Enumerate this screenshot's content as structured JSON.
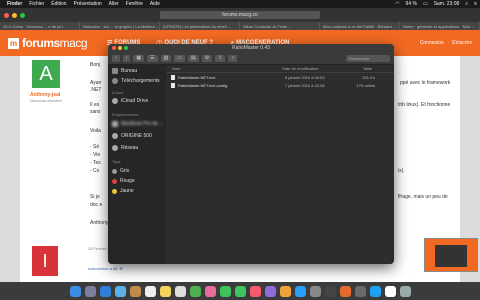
{
  "menubar": {
    "apple": "",
    "items": [
      "Finder",
      "Fichier",
      "Édition",
      "Présentation",
      "Aller",
      "Fenêtre",
      "Aide"
    ],
    "battery": "94 %",
    "clock": "Sam. 23:08"
  },
  "browser": {
    "url": "forums.macg.co",
    "tabs": [
      "13 X Cobra · Nouveau ... e de jeu.",
      "Netscolor · sur ... et graphic | La Meilleur ...",
      "[UPDATE] Les jailbreakers du réveil ...",
      "Nikon Coolscan Je Fiche ...",
      "déco codeurs à ce fmt Faildé · Bleuard ...",
      "Netex · générale et applications · Moe ..."
    ]
  },
  "forum": {
    "logo_letter": "m",
    "logo_main": "forums",
    "logo_sub": "macg",
    "nav": [
      "FORUMS",
      "QUOI DE NEUF ?",
      "MACGENERATION"
    ],
    "right": [
      "Connexion",
      "S'inscrire"
    ]
  },
  "post": {
    "avatar_letter": "A",
    "user": "Anthony-jeal",
    "role": "Nouveau membre",
    "lines": [
      "Bonj",
      "Ayan",
      ".NET",
      "Il es",
      "sans",
      "Voila",
      "- Sé",
      "- Vie",
      "- Tes",
      "- Co",
      "Si je",
      "doc e",
      "Anthony."
    ],
    "right_fragments": [
      "ppé avec le framework",
      "trib linux). Et fonctionne",
      "ix).",
      "ffrage, mais un peu de"
    ],
    "date": "28 Février 2017",
    "second_avatar": "I",
    "reply": "macomnies a dit: ⊕"
  },
  "finder": {
    "title": "RatioMaster 0.43",
    "search_placeholder": "Rechercher",
    "sidebar": {
      "favorites": [
        "Bureau",
        "Téléchargements"
      ],
      "icloud_head": "iCloud",
      "icloud": [
        "iCloud Drive"
      ],
      "devices_head": "Emplacements",
      "devices": [
        "MacBook Pro de ...",
        "ORIGINE 500",
        "Réseau"
      ],
      "tags_head": "Tags",
      "tags": [
        "Gris",
        "Rouge",
        "Jaune"
      ]
    },
    "columns": {
      "name": "Nom",
      "date": "Date de modification",
      "size": "Taille"
    },
    "files": [
      {
        "name": "RatioMaster.NET.exe",
        "date": "6 janvier 2016 à 00:53",
        "size": "221 Ko"
      },
      {
        "name": "RatioMaster.NET.exe.config",
        "date": "7 janvier 2016 à 22:08",
        "size": "175 octets"
      }
    ]
  },
  "colors": {
    "forum_orange": "#f26922",
    "avatar_green": "#3daa4f",
    "avatar_red": "#d9333a"
  }
}
